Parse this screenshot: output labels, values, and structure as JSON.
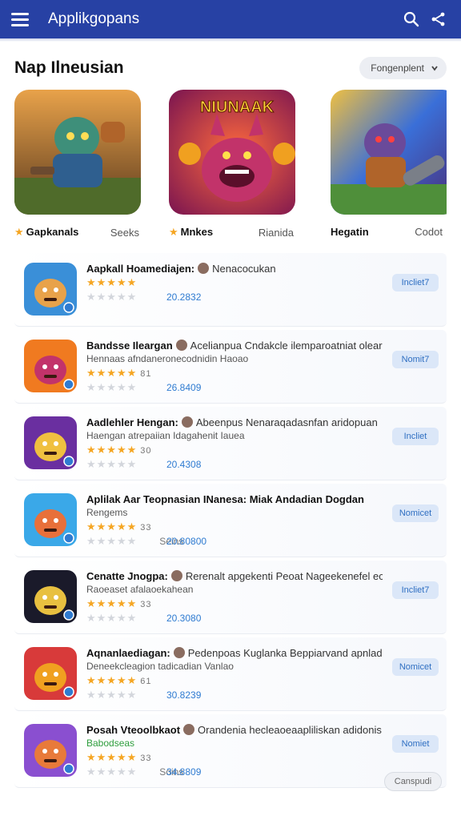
{
  "appbar": {
    "title": "Applikgopans"
  },
  "section": {
    "title": "Nap Ilneusian",
    "sort_label": "Fongenplent"
  },
  "featured": [
    {
      "name": "Gapkanals",
      "sub": "Seeks",
      "starred": true
    },
    {
      "name": "Mnkes",
      "sub": "Rianida",
      "starred": true,
      "tile_text": "NIUNAAK"
    },
    {
      "name": "Hegatin",
      "sub": "Codot",
      "starred": false
    }
  ],
  "items": [
    {
      "title": "Aapkall Hoamediajen:",
      "desc": "Nenacocukan",
      "desc2": "",
      "rating_count": "",
      "sub_label": "",
      "number": "20.2832",
      "action": "Incliet7"
    },
    {
      "title": "Bandsse Ileargan",
      "desc": "Acelianpua Cndakcle ilemparoatniat oleara",
      "desc2": "Hennaas afndaneronecodnidin Haoao",
      "rating_count": "81",
      "sub_label": "",
      "number": "26.8409",
      "action": "Nomit7"
    },
    {
      "title": "Aadlehler Hengan:",
      "desc": "Abeenpus Nenaraqadasnfan aridopuan",
      "desc2": "Haengan atrepaiian Idagahenit Iauea",
      "rating_count": "30",
      "sub_label": "",
      "number": "20.4308",
      "action": "Incliet"
    },
    {
      "title": "Aplilak Aar Teopnasian INanesa: Miak Andadian Dogdan",
      "desc": "",
      "desc2": "Rengems",
      "rating_count": "33",
      "sub_label": "Seins",
      "number": "20.80800",
      "action": "Nomicet"
    },
    {
      "title": "Cenatte Jnogpa:",
      "desc": "Rerenalt apgekenti Peoat Nageekenefel ecioauin.",
      "desc2": "Raoeaset afalaoekahean",
      "rating_count": "33",
      "sub_label": "",
      "number": "20.3080",
      "action": "Incliet7"
    },
    {
      "title": "Aqnanlaediagan:",
      "desc": "Pedenpoas Kuglanka Beppiarvand apnladan",
      "desc2": "Deneekcleagion tadicadian Vanlao",
      "rating_count": "61",
      "sub_label": "",
      "number": "30.8239",
      "action": "Nomicet"
    },
    {
      "title": "Posah Vteoolbkaot",
      "desc": "Orandenia hecleaoeaapliliskan adidonis",
      "desc2": "Babodseas",
      "rating_count": "33",
      "sub_label": "Soins",
      "number": "34.8809",
      "action": "Nomiet"
    }
  ],
  "fab": {
    "label": "Canspudi"
  },
  "colors": {
    "appbar": "#2741a4",
    "star": "#f5a623",
    "accent": "#2f7bd1"
  }
}
